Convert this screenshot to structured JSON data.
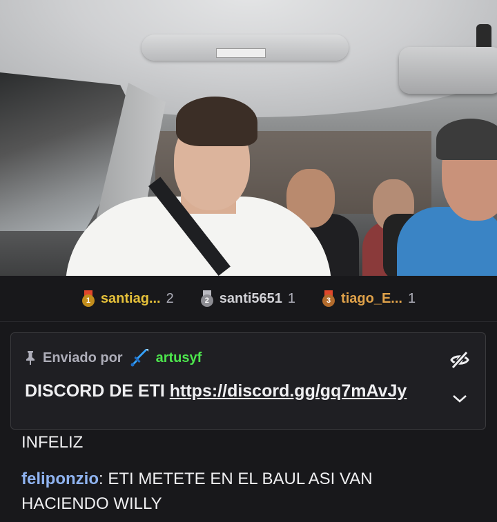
{
  "leaderboard": [
    {
      "rank": "1",
      "name": "santiag...",
      "count": "2",
      "name_color": "#e6c13a",
      "medal_color": "#c28d1c",
      "ribbon_color": "#e0472b"
    },
    {
      "rank": "2",
      "name": "santi5651",
      "count": "1",
      "name_color": "#d1d1d6",
      "medal_color": "#8d8d93",
      "ribbon_color": "#b9b9c0"
    },
    {
      "rank": "3",
      "name": "tiago_E...",
      "count": "1",
      "name_color": "#e0a24a",
      "medal_color": "#b36b2c",
      "ribbon_color": "#e0472b"
    }
  ],
  "pinned": {
    "label": "Enviado por",
    "user": "artusyf",
    "user_color": "#4de54d",
    "text": "DISCORD DE ETI ",
    "link": "https://discord.gg/gq7mAvJy"
  },
  "chat": {
    "partial_line": "INFELIZ",
    "messages": [
      {
        "user": "feliponzio",
        "separator": ":",
        "text_line1": " ETI METETE EN EL BAUL ASI VAN",
        "text_line2": "HACIENDO WILLY"
      }
    ]
  },
  "icons": {
    "pin": "pin-icon",
    "badge": "sword-icon",
    "hide": "eye-off-icon",
    "expand": "chevron-down-icon"
  }
}
